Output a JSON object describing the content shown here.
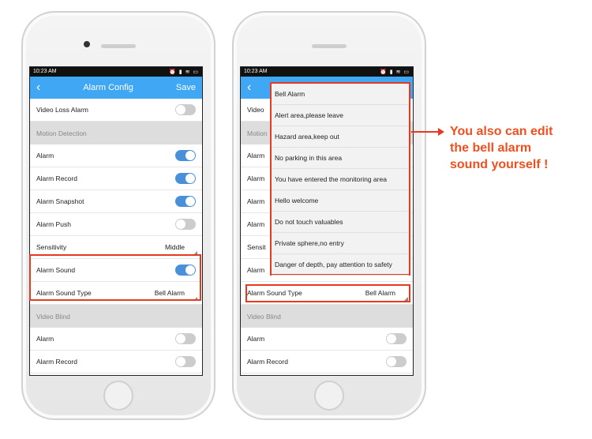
{
  "left_phone": {
    "status": {
      "time": "10:23 AM",
      "icons": "⏰ ▮ ≋ ▭"
    },
    "header": {
      "back": "‹",
      "title": "Alarm Config",
      "save": "Save"
    },
    "rows": [
      {
        "type": "toggle",
        "label": "Video Loss Alarm",
        "on": false
      },
      {
        "type": "section",
        "label": "Motion Detection"
      },
      {
        "type": "toggle",
        "label": "Alarm",
        "on": true
      },
      {
        "type": "toggle",
        "label": "Alarm Record",
        "on": true
      },
      {
        "type": "toggle",
        "label": "Alarm Snapshot",
        "on": true
      },
      {
        "type": "toggle",
        "label": "Alarm Push",
        "on": false
      },
      {
        "type": "select",
        "label": "Sensitivity",
        "value": "Middle"
      },
      {
        "type": "toggle",
        "label": "Alarm Sound",
        "on": true
      },
      {
        "type": "select",
        "label": "Alarm Sound Type",
        "value": "Bell Alarm"
      },
      {
        "type": "section",
        "label": "Video Blind"
      },
      {
        "type": "toggle",
        "label": "Alarm",
        "on": false
      },
      {
        "type": "toggle",
        "label": "Alarm Record",
        "on": false
      }
    ]
  },
  "right_phone": {
    "status": {
      "time": "10:23 AM",
      "icons": "⏰ ▮ ≋ ▭"
    },
    "header": {
      "back": "‹",
      "title": "",
      "save": ""
    },
    "rows": [
      {
        "type": "toggle",
        "label": "Video",
        "on": false
      },
      {
        "type": "section",
        "label": "Motion"
      },
      {
        "type": "toggle",
        "label": "Alarm",
        "on": true
      },
      {
        "type": "toggle",
        "label": "Alarm",
        "on": true
      },
      {
        "type": "toggle",
        "label": "Alarm",
        "on": true
      },
      {
        "type": "toggle",
        "label": "Alarm",
        "on": false
      },
      {
        "type": "select",
        "label": "Sensit",
        "value": ""
      },
      {
        "type": "toggle",
        "label": "Alarm",
        "on": true
      },
      {
        "type": "select",
        "label": "Alarm Sound Type",
        "value": "Bell Alarm"
      },
      {
        "type": "section",
        "label": "Video Blind"
      },
      {
        "type": "toggle",
        "label": "Alarm",
        "on": false
      },
      {
        "type": "toggle",
        "label": "Alarm Record",
        "on": false
      }
    ],
    "dropdown_options": [
      "Bell Alarm",
      "Alert area,please leave",
      "Hazard area,keep out",
      "No parking in this area",
      "You have entered the monitoring area",
      "Hello welcome",
      "Do not touch valuables",
      "Private sphere,no entry",
      "Danger of depth, pay attention to safety"
    ]
  },
  "callout": {
    "line1": "You also can edit",
    "line2": "the bell alarm",
    "line3": "sound yourself !"
  },
  "colors": {
    "accent": "#3fa7f3",
    "toggle_on": "#4a90d9",
    "highlight": "#e53a1f",
    "callout": "#f0501f"
  }
}
